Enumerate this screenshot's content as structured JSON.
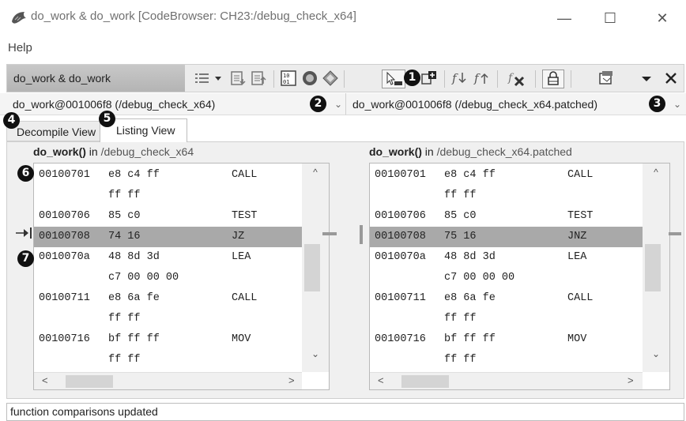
{
  "window": {
    "title": "do_work & do_work [CodeBrowser: CH23:/debug_check_x64]",
    "minimize": "—",
    "maximize": "☐",
    "close": "✕"
  },
  "menu": {
    "help": "Help"
  },
  "toolbar": {
    "title": "do_work & do_work",
    "icons": [
      "list-menu-icon",
      "dropdown-arrow-icon",
      "export-icon",
      "import-icon",
      "binary-icon",
      "circle-icon",
      "diamond-icon",
      "cursor-select-icon",
      "add-function-icon",
      "down-arrow-f-icon",
      "up-arrow-f-icon",
      "delete-function-icon",
      "lock-icon",
      "snapshot-icon",
      "menu-down-icon",
      "close-panel-icon"
    ]
  },
  "left_program": {
    "label": "do_work@001006f8 (/debug_check_x64)"
  },
  "right_program": {
    "label": "do_work@001006f8 (/debug_check_x64.patched)"
  },
  "badges": {
    "b1": "1",
    "b2": "2",
    "b3": "3",
    "b4": "4",
    "b5": "5",
    "b6": "6",
    "b7": "7"
  },
  "tabs": {
    "decompile": "Decompile View",
    "listing": "Listing View"
  },
  "left_panel": {
    "func": "do_work()",
    "in": " in ",
    "path": "/debug_check_x64",
    "rows": [
      {
        "addr": "00100701",
        "bytes": "e8 c4 ff",
        "mnem": "CALL"
      },
      {
        "addr": "",
        "bytes": "ff ff",
        "mnem": ""
      },
      {
        "addr": "00100706",
        "bytes": "85 c0",
        "mnem": "TEST"
      },
      {
        "addr": "00100708",
        "bytes": "74 16",
        "mnem": "JZ"
      },
      {
        "addr": "0010070a",
        "bytes": "48 8d 3d",
        "mnem": "LEA"
      },
      {
        "addr": "",
        "bytes": "c7 00 00 00",
        "mnem": ""
      },
      {
        "addr": "00100711",
        "bytes": "e8 6a fe",
        "mnem": "CALL"
      },
      {
        "addr": "",
        "bytes": "ff ff",
        "mnem": ""
      },
      {
        "addr": "00100716",
        "bytes": "bf ff ff",
        "mnem": "MOV"
      },
      {
        "addr": "",
        "bytes": "ff ff",
        "mnem": ""
      }
    ]
  },
  "right_panel": {
    "func": "do_work()",
    "in": " in ",
    "path": "/debug_check_x64.patched",
    "rows": [
      {
        "addr": "00100701",
        "bytes": "e8 c4 ff",
        "mnem": "CALL"
      },
      {
        "addr": "",
        "bytes": "ff ff",
        "mnem": ""
      },
      {
        "addr": "00100706",
        "bytes": "85 c0",
        "mnem": "TEST"
      },
      {
        "addr": "00100708",
        "bytes": "75 16",
        "mnem": "JNZ"
      },
      {
        "addr": "0010070a",
        "bytes": "48 8d 3d",
        "mnem": "LEA"
      },
      {
        "addr": "",
        "bytes": "c7 00 00 00",
        "mnem": ""
      },
      {
        "addr": "00100711",
        "bytes": "e8 6a fe",
        "mnem": "CALL"
      },
      {
        "addr": "",
        "bytes": "ff ff",
        "mnem": ""
      },
      {
        "addr": "00100716",
        "bytes": "bf ff ff",
        "mnem": "MOV"
      },
      {
        "addr": "",
        "bytes": "ff ff",
        "mnem": ""
      }
    ]
  },
  "highlight_row": 3,
  "scroll": {
    "up": "^",
    "down": "⌄",
    "left": "<",
    "right": ">"
  },
  "status": {
    "text": "function comparisons updated"
  },
  "colors": {
    "highlight": "#a9a9a9",
    "toolbar_title_bg": "#bdbdbd"
  }
}
